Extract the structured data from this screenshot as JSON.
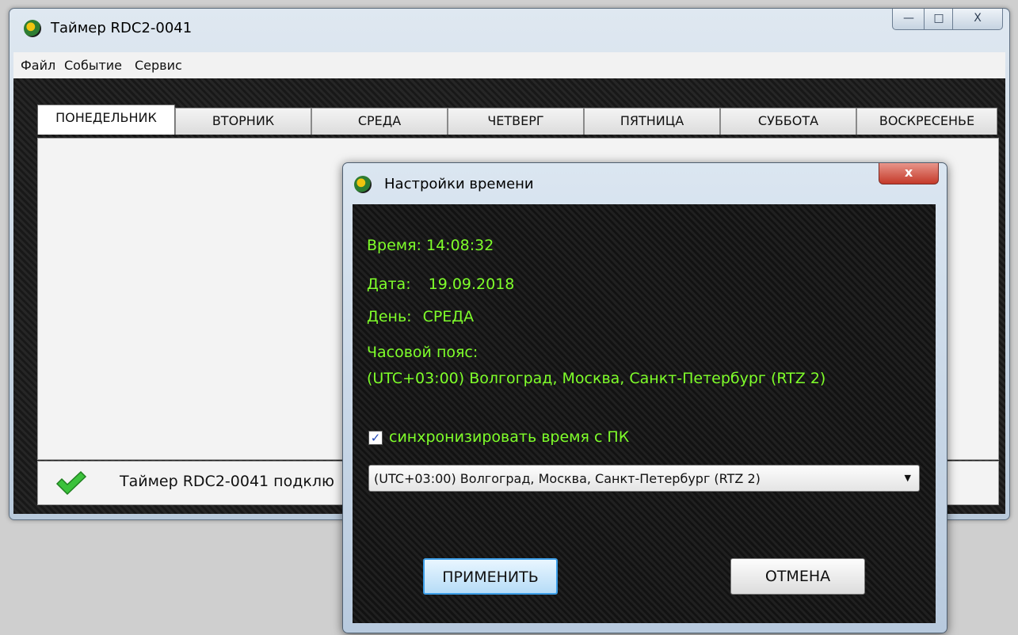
{
  "main_window": {
    "title": "Таймер RDC2-0041",
    "controls": {
      "minimize": "—",
      "maximize": "□",
      "close": "X"
    },
    "menu": [
      "Файл",
      "Событие",
      "Сервис"
    ],
    "tabs": [
      "ПОНЕДЕЛЬНИК",
      "ВТОРНИК",
      "СРЕДА",
      "ЧЕТВЕРГ",
      "ПЯТНИЦА",
      "СУББОТА",
      "ВОСКРЕСЕНЬЕ"
    ],
    "active_tab": "ПОНЕДЕЛЬНИК",
    "status": {
      "icon": "checkmark-icon",
      "text": "Таймер RDC2-0041 подклю"
    }
  },
  "dialog": {
    "title": "Настройки времени",
    "close_label": "x",
    "time_label": "Время:",
    "time_value": "14:08:32",
    "date_label": "Дата:",
    "date_value": "19.09.2018",
    "day_label": "День:",
    "day_value": "СРЕДА",
    "timezone_label": "Часовой пояс:",
    "timezone_value": "(UTC+03:00) Волгоград, Москва, Санкт-Петербург (RTZ 2)",
    "sync_checked": true,
    "sync_label": "синхронизировать время с ПК",
    "select_value": "(UTC+03:00) Волгоград, Москва, Санкт-Петербург (RTZ 2)",
    "apply_button": "ПРИМЕНИТЬ",
    "cancel_button": "ОТМЕНА"
  },
  "colors": {
    "accent_text": "#7fff2a",
    "apply_button_border": "#3c9ee8",
    "close_button": "#c43a2a"
  }
}
